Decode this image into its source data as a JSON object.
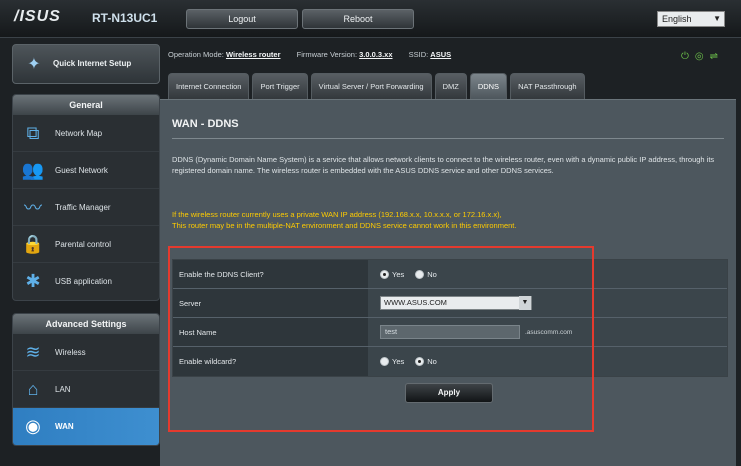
{
  "header": {
    "logo": "/ISUS",
    "model": "RT-N13UC1",
    "logout_label": "Logout",
    "reboot_label": "Reboot",
    "language": "English"
  },
  "sidebar": {
    "quick_setup_label": "Quick Internet Setup",
    "general_title": "General",
    "general_items": [
      {
        "label": "Network Map",
        "icon": "network-map-icon"
      },
      {
        "label": "Guest Network",
        "icon": "guest-network-icon"
      },
      {
        "label": "Traffic Manager",
        "icon": "traffic-manager-icon"
      },
      {
        "label": "Parental control",
        "icon": "parental-control-icon"
      },
      {
        "label": "USB application",
        "icon": "usb-application-icon"
      }
    ],
    "advanced_title": "Advanced Settings",
    "advanced_items": [
      {
        "label": "Wireless",
        "icon": "wireless-icon"
      },
      {
        "label": "LAN",
        "icon": "lan-icon"
      },
      {
        "label": "WAN",
        "icon": "wan-globe-icon"
      }
    ]
  },
  "status": {
    "op_mode_label": "Operation Mode:",
    "op_mode_value": "Wireless router",
    "firmware_label": "Firmware Version:",
    "firmware_value": "3.0.0.3.xx",
    "ssid_label": "SSID:",
    "ssid_value": "ASUS"
  },
  "tabs": [
    {
      "label": "Internet Connection",
      "active": false
    },
    {
      "label": "Port Trigger",
      "active": false
    },
    {
      "label": "Virtual Server / Port Forwarding",
      "active": false
    },
    {
      "label": "DMZ",
      "active": false
    },
    {
      "label": "DDNS",
      "active": true
    },
    {
      "label": "NAT Passthrough",
      "active": false
    }
  ],
  "main": {
    "title": "WAN - DDNS",
    "description": "DDNS (Dynamic Domain Name System) is a service that allows network clients to connect to the wireless router, even with a dynamic public IP address, through its registered domain name. The wireless router is embedded with the ASUS DDNS service and other DDNS services.",
    "warning_1": "If the wireless router currently uses a private WAN IP address (192.168.x.x, 10.x.x.x, or 172.16.x.x),",
    "warning_2": "This router may be in the multiple-NAT environment and DDNS service cannot work in this environment.",
    "form": {
      "enable_ddns_label": "Enable the DDNS Client?",
      "enable_yes": "Yes",
      "enable_no": "No",
      "server_label": "Server",
      "server_value": "WWW.ASUS.COM",
      "hostname_label": "Host Name",
      "hostname_value": "test",
      "hostname_suffix": ".asuscomm.com",
      "wildcard_label": "Enable wildcard?",
      "wildcard_yes": "Yes",
      "wildcard_no": "No"
    },
    "apply_label": "Apply"
  },
  "colors": {
    "accent": "#3e8fd0",
    "warning": "#ffcc00",
    "highlight": "#e53a2e"
  }
}
